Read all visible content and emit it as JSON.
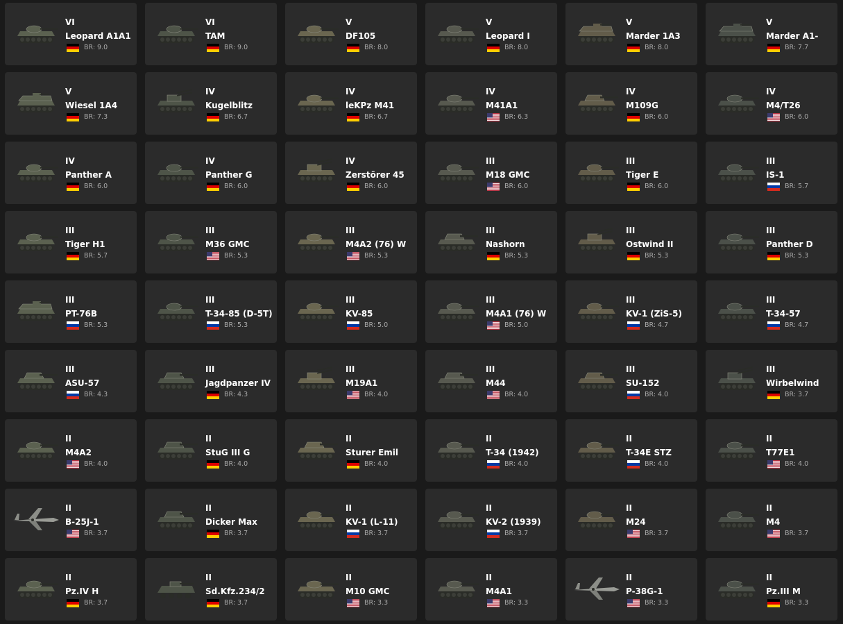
{
  "br_prefix": "BR: ",
  "flag_colors": {
    "de": [
      "#000000",
      "#dd0000",
      "#ffce00"
    ],
    "us": [
      "#b22234",
      "#ffffff",
      "#3c3b6e"
    ],
    "ru": [
      "#ffffff",
      "#0039a6",
      "#d52b1e"
    ]
  },
  "vehicles": [
    {
      "rank": "VI",
      "name": "Leopard A1A1",
      "nation": "de",
      "br": "9.0",
      "icon": "tank-icon"
    },
    {
      "rank": "VI",
      "name": "TAM",
      "nation": "de",
      "br": "9.0",
      "icon": "tank-icon"
    },
    {
      "rank": "V",
      "name": "DF105",
      "nation": "de",
      "br": "8.0",
      "icon": "tank-icon"
    },
    {
      "rank": "V",
      "name": "Leopard I",
      "nation": "de",
      "br": "8.0",
      "icon": "tank-icon"
    },
    {
      "rank": "V",
      "name": "Marder 1A3",
      "nation": "de",
      "br": "8.0",
      "icon": "ifv-icon"
    },
    {
      "rank": "V",
      "name": "Marder A1-",
      "nation": "de",
      "br": "7.7",
      "icon": "ifv-icon"
    },
    {
      "rank": "V",
      "name": "Wiesel 1A4",
      "nation": "de",
      "br": "7.3",
      "icon": "ifv-icon"
    },
    {
      "rank": "IV",
      "name": "Kugelblitz",
      "nation": "de",
      "br": "6.7",
      "icon": "spaa-icon"
    },
    {
      "rank": "IV",
      "name": "leKPz M41",
      "nation": "de",
      "br": "6.7",
      "icon": "tank-icon"
    },
    {
      "rank": "IV",
      "name": "M41A1",
      "nation": "us",
      "br": "6.3",
      "icon": "tank-icon"
    },
    {
      "rank": "IV",
      "name": "M109G",
      "nation": "de",
      "br": "6.0",
      "icon": "spg-icon"
    },
    {
      "rank": "IV",
      "name": "M4/T26",
      "nation": "us",
      "br": "6.0",
      "icon": "tank-icon"
    },
    {
      "rank": "IV",
      "name": "Panther A",
      "nation": "de",
      "br": "6.0",
      "icon": "tank-icon"
    },
    {
      "rank": "IV",
      "name": "Panther G",
      "nation": "de",
      "br": "6.0",
      "icon": "tank-icon"
    },
    {
      "rank": "IV",
      "name": "Zerstörer 45",
      "nation": "de",
      "br": "6.0",
      "icon": "spaa-icon"
    },
    {
      "rank": "III",
      "name": "M18 GMC",
      "nation": "us",
      "br": "6.0",
      "icon": "tank-icon"
    },
    {
      "rank": "III",
      "name": "Tiger E",
      "nation": "de",
      "br": "6.0",
      "icon": "tank-icon"
    },
    {
      "rank": "III",
      "name": "IS-1",
      "nation": "ru",
      "br": "5.7",
      "icon": "tank-icon"
    },
    {
      "rank": "III",
      "name": "Tiger H1",
      "nation": "de",
      "br": "5.7",
      "icon": "tank-icon"
    },
    {
      "rank": "III",
      "name": "M36 GMC",
      "nation": "us",
      "br": "5.3",
      "icon": "tank-icon"
    },
    {
      "rank": "III",
      "name": "M4A2 (76) W",
      "nation": "us",
      "br": "5.3",
      "icon": "tank-icon"
    },
    {
      "rank": "III",
      "name": "Nashorn",
      "nation": "de",
      "br": "5.3",
      "icon": "spg-icon"
    },
    {
      "rank": "III",
      "name": "Ostwind II",
      "nation": "de",
      "br": "5.3",
      "icon": "spaa-icon"
    },
    {
      "rank": "III",
      "name": "Panther D",
      "nation": "de",
      "br": "5.3",
      "icon": "tank-icon"
    },
    {
      "rank": "III",
      "name": "PT-76B",
      "nation": "ru",
      "br": "5.3",
      "icon": "ifv-icon"
    },
    {
      "rank": "III",
      "name": "T-34-85 (D-5T)",
      "nation": "ru",
      "br": "5.3",
      "icon": "tank-icon"
    },
    {
      "rank": "III",
      "name": "KV-85",
      "nation": "ru",
      "br": "5.0",
      "icon": "tank-icon"
    },
    {
      "rank": "III",
      "name": "M4A1 (76) W",
      "nation": "us",
      "br": "5.0",
      "icon": "tank-icon"
    },
    {
      "rank": "III",
      "name": "KV-1 (ZiS-5)",
      "nation": "ru",
      "br": "4.7",
      "icon": "tank-icon"
    },
    {
      "rank": "III",
      "name": "T-34-57",
      "nation": "ru",
      "br": "4.7",
      "icon": "tank-icon"
    },
    {
      "rank": "III",
      "name": "ASU-57",
      "nation": "ru",
      "br": "4.3",
      "icon": "spg-icon"
    },
    {
      "rank": "III",
      "name": "Jagdpanzer IV",
      "nation": "de",
      "br": "4.3",
      "icon": "spg-icon"
    },
    {
      "rank": "III",
      "name": "M19A1",
      "nation": "us",
      "br": "4.0",
      "icon": "spaa-icon"
    },
    {
      "rank": "III",
      "name": "M44",
      "nation": "us",
      "br": "4.0",
      "icon": "spg-icon"
    },
    {
      "rank": "III",
      "name": "SU-152",
      "nation": "ru",
      "br": "4.0",
      "icon": "spg-icon"
    },
    {
      "rank": "III",
      "name": "Wirbelwind",
      "nation": "de",
      "br": "3.7",
      "icon": "spaa-icon"
    },
    {
      "rank": "II",
      "name": "M4A2",
      "nation": "us",
      "br": "4.0",
      "icon": "tank-icon"
    },
    {
      "rank": "II",
      "name": "StuG III G",
      "nation": "de",
      "br": "4.0",
      "icon": "spg-icon"
    },
    {
      "rank": "II",
      "name": "Sturer Emil",
      "nation": "de",
      "br": "4.0",
      "icon": "spg-icon"
    },
    {
      "rank": "II",
      "name": "T-34 (1942)",
      "nation": "ru",
      "br": "4.0",
      "icon": "tank-icon"
    },
    {
      "rank": "II",
      "name": "T-34E STZ",
      "nation": "ru",
      "br": "4.0",
      "icon": "tank-icon"
    },
    {
      "rank": "II",
      "name": "T77E1",
      "nation": "us",
      "br": "4.0",
      "icon": "tank-icon"
    },
    {
      "rank": "II",
      "name": "B-25J-1",
      "nation": "us",
      "br": "3.7",
      "icon": "plane-icon"
    },
    {
      "rank": "II",
      "name": "Dicker Max",
      "nation": "de",
      "br": "3.7",
      "icon": "spg-icon"
    },
    {
      "rank": "II",
      "name": "KV-1 (L-11)",
      "nation": "ru",
      "br": "3.7",
      "icon": "tank-icon"
    },
    {
      "rank": "II",
      "name": "KV-2 (1939)",
      "nation": "ru",
      "br": "3.7",
      "icon": "tank-icon"
    },
    {
      "rank": "II",
      "name": "M24",
      "nation": "us",
      "br": "3.7",
      "icon": "tank-icon"
    },
    {
      "rank": "II",
      "name": "M4",
      "nation": "us",
      "br": "3.7",
      "icon": "tank-icon"
    },
    {
      "rank": "II",
      "name": "Pz.IV H",
      "nation": "de",
      "br": "3.7",
      "icon": "tank-icon"
    },
    {
      "rank": "II",
      "name": "Sd.Kfz.234/2",
      "nation": "de",
      "br": "3.7",
      "icon": "armored-car-icon"
    },
    {
      "rank": "II",
      "name": "M10 GMC",
      "nation": "us",
      "br": "3.3",
      "icon": "tank-icon"
    },
    {
      "rank": "II",
      "name": "M4A1",
      "nation": "us",
      "br": "3.3",
      "icon": "tank-icon"
    },
    {
      "rank": "II",
      "name": "P-38G-1",
      "nation": "us",
      "br": "3.3",
      "icon": "plane-icon"
    },
    {
      "rank": "II",
      "name": "Pz.III M",
      "nation": "de",
      "br": "3.3",
      "icon": "tank-icon"
    }
  ]
}
